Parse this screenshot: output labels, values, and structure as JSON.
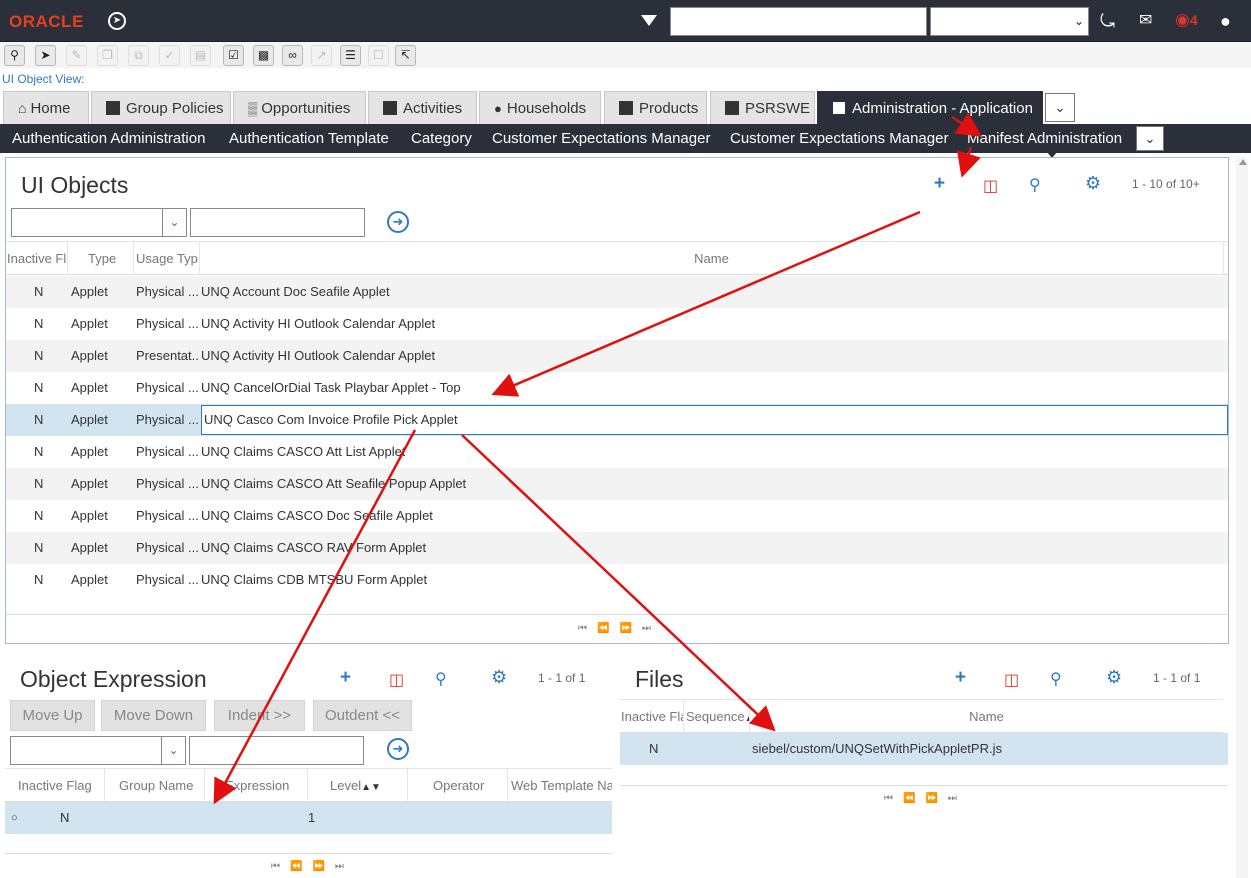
{
  "header": {
    "logo": "ORACLE",
    "search_value": "",
    "select_value": "",
    "notification_count": "4",
    "icons": [
      "share-icon",
      "chat-icon",
      "notification-icon",
      "user-icon"
    ]
  },
  "toolbar_icons": [
    "search-icon",
    "go-icon",
    "edit-icon",
    "copy-icon",
    "merge-icon",
    "sign-icon",
    "doc-icon",
    "checklist-icon",
    "clipboard-icon",
    "workflow-icon",
    "export-icon",
    "list-icon",
    "note-icon",
    "chart-icon"
  ],
  "ui_object_view_label": "UI Object View:",
  "tabs": [
    {
      "label": "Home"
    },
    {
      "label": "Group Policies"
    },
    {
      "label": "Opportunities"
    },
    {
      "label": "Activities"
    },
    {
      "label": "Households"
    },
    {
      "label": "Products"
    },
    {
      "label": "PSRSWE"
    },
    {
      "label": "Administration - Application"
    }
  ],
  "subnav": [
    {
      "label": "Authentication Administration"
    },
    {
      "label": "Authentication Template"
    },
    {
      "label": "Category"
    },
    {
      "label": "Customer Expectations Manager"
    },
    {
      "label": "Customer Expectations Manager"
    },
    {
      "label": "Manifest Administration"
    }
  ],
  "ui_objects": {
    "title": "UI Objects",
    "count": "1 - 10 of 10+",
    "columns": [
      "Inactive Flag",
      "Type",
      "Usage Typ",
      "Name"
    ],
    "rows": [
      [
        "N",
        "Applet",
        "Physical ...",
        "UNQ Account Doc Seafile Applet"
      ],
      [
        "N",
        "Applet",
        "Physical ...",
        "UNQ Activity HI Outlook Calendar Applet"
      ],
      [
        "N",
        "Applet",
        "Presentat...",
        "UNQ Activity HI Outlook Calendar Applet"
      ],
      [
        "N",
        "Applet",
        "Physical ...",
        "UNQ CancelOrDial Task Playbar Applet - Top"
      ],
      [
        "N",
        "Applet",
        "Physical ...",
        "UNQ Casco Com Invoice Profile Pick Applet"
      ],
      [
        "N",
        "Applet",
        "Physical ...",
        "UNQ Claims CASCO Att List Applet"
      ],
      [
        "N",
        "Applet",
        "Physical ...",
        "UNQ Claims CASCO Att Seafile Popup Applet"
      ],
      [
        "N",
        "Applet",
        "Physical ...",
        "UNQ Claims CASCO Doc Seafile Applet"
      ],
      [
        "N",
        "Applet",
        "Physical ...",
        "UNQ Claims CASCO RAV Form Applet"
      ],
      [
        "N",
        "Applet",
        "Physical ...",
        "UNQ Claims CDB MTSBU Form Applet"
      ]
    ]
  },
  "object_expression": {
    "title": "Object Expression",
    "count": "1 - 1 of 1",
    "buttons": [
      "Move Up",
      "Move Down",
      "Indent >>",
      "Outdent <<"
    ],
    "columns": [
      "Inactive Flag",
      "Group Name",
      "Expression",
      "Level",
      "Operator",
      "Web Template Na"
    ],
    "rows": [
      [
        "N",
        "",
        "",
        "1",
        "",
        ""
      ]
    ]
  },
  "files": {
    "title": "Files",
    "count": "1 - 1 of 1",
    "columns": [
      "Inactive Flag",
      "Sequence",
      "Name"
    ],
    "rows": [
      [
        "N",
        "",
        "siebel/custom/UNQSetWithPickAppletPR.js"
      ]
    ]
  },
  "annotation_color": "#e01010"
}
